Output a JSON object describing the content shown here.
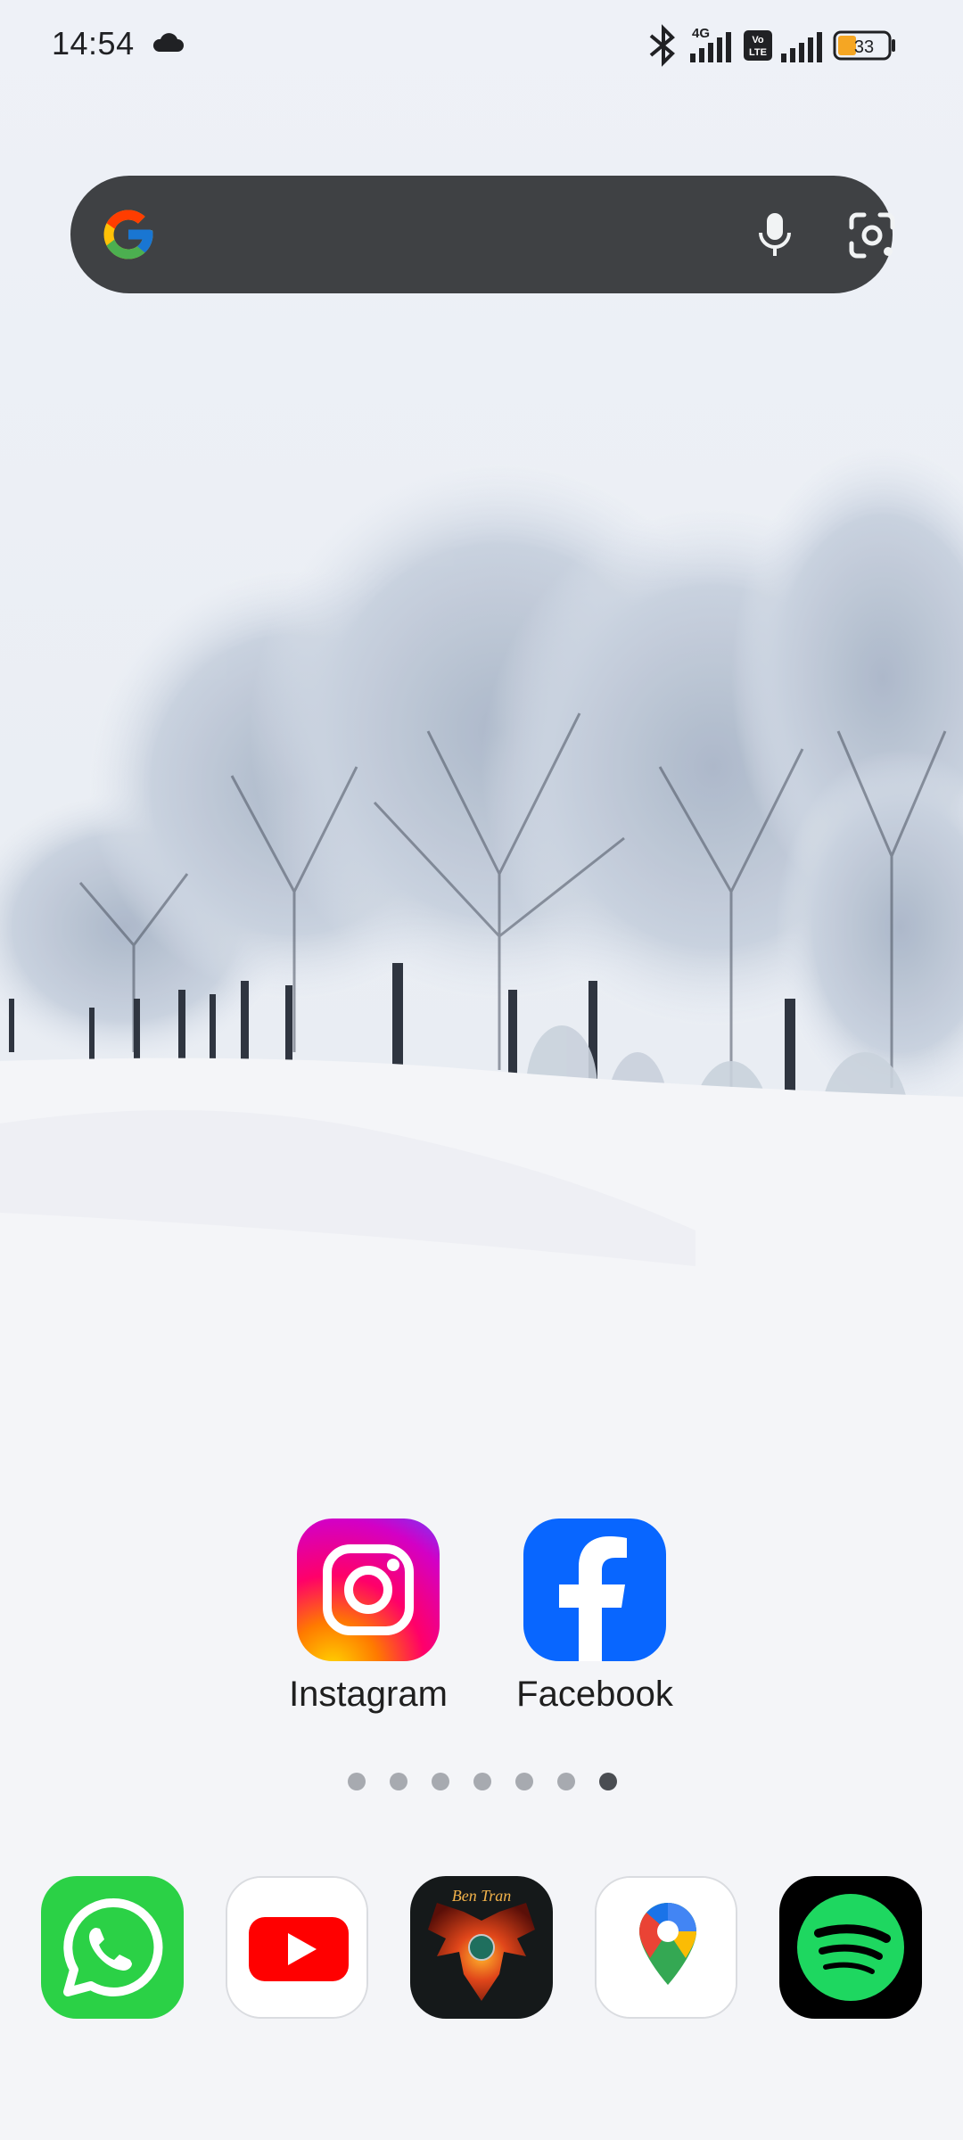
{
  "status_bar": {
    "time": "14:54",
    "network_label": "4G",
    "volte_label": "Vo LTE",
    "battery_percent": "33",
    "icons": [
      "cloud-icon",
      "bluetooth-icon",
      "signal-icon",
      "volte-icon",
      "battery-icon"
    ]
  },
  "search_widget": {
    "icons": [
      "google-g-icon",
      "microphone-icon",
      "google-lens-icon"
    ]
  },
  "home_apps": [
    {
      "label": "Instagram",
      "icon": "instagram-icon"
    },
    {
      "label": "Facebook",
      "icon": "facebook-icon"
    }
  ],
  "page_indicator": {
    "pages": 7,
    "current": 7
  },
  "dock": [
    {
      "app": "WhatsApp",
      "icon": "whatsapp-icon"
    },
    {
      "app": "YouTube",
      "icon": "youtube-icon"
    },
    {
      "app": "Ben Tran",
      "icon": "ben-tran-phoenix-icon",
      "icon_text": "Ben Tran"
    },
    {
      "app": "Maps",
      "icon": "google-maps-icon"
    },
    {
      "app": "Spotify",
      "icon": "spotify-icon"
    }
  ],
  "colors": {
    "search_bar_bg": "#3f4144",
    "whatsapp": "#2bd146",
    "youtube": "#ff0000",
    "facebook": "#0866ff",
    "spotify": "#1ed760",
    "battery_fill": "#f5a623"
  }
}
